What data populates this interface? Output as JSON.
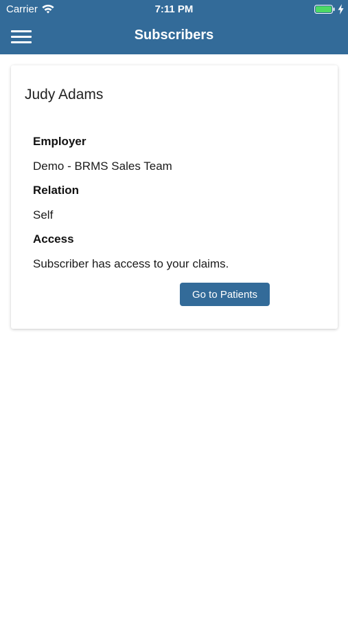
{
  "status_bar": {
    "carrier": "Carrier",
    "time": "7:11 PM",
    "battery_color": "#4cd964"
  },
  "nav": {
    "title": "Subscribers",
    "menu_icon": "hamburger-menu-icon",
    "background": "#336b99"
  },
  "subscriber": {
    "name": "Judy Adams",
    "employer_label": "Employer",
    "employer_value": "Demo - BRMS Sales Team",
    "relation_label": "Relation",
    "relation_value": "Self",
    "access_label": "Access",
    "access_value": "Subscriber has access to your claims.",
    "button_label": "Go to Patients"
  }
}
